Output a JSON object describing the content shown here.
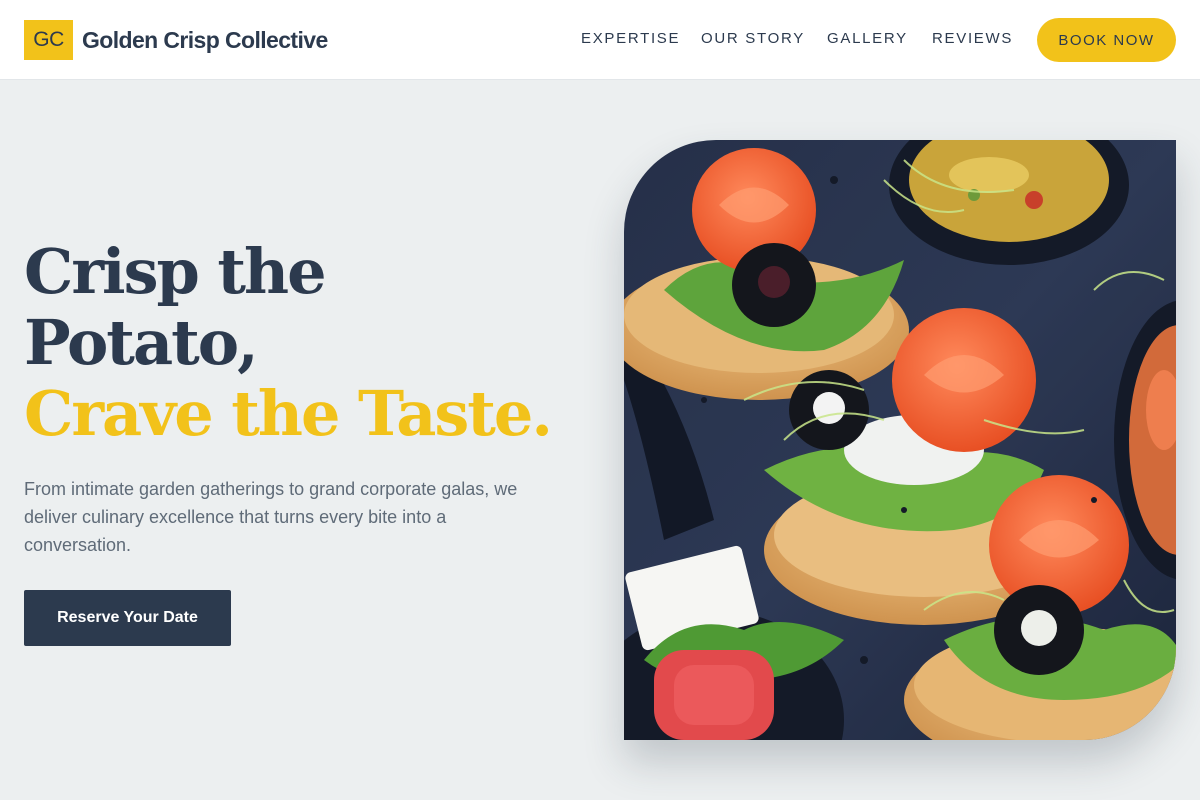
{
  "brand": {
    "logo_text": "GC",
    "name": "Golden Crisp Collective"
  },
  "nav": {
    "links": [
      "EXPERTISE",
      "OUR STORY",
      "GALLERY",
      "REVIEWS"
    ],
    "cta_label": "BOOK NOW"
  },
  "hero": {
    "title_line1": "Crisp the",
    "title_line2": "Potato,",
    "title_accent": "Crave the Taste.",
    "description": "From intimate garden gatherings to grand corporate galas, we deliver culinary excellence that turns every bite into a conversation.",
    "cta_label": "Reserve Your Date",
    "image_label": "canape-platter-photo"
  },
  "colors": {
    "accent": "#F2C21A",
    "navy": "#2C3A4E",
    "background": "#ECEFF0",
    "muted_text": "#5F6B78"
  }
}
